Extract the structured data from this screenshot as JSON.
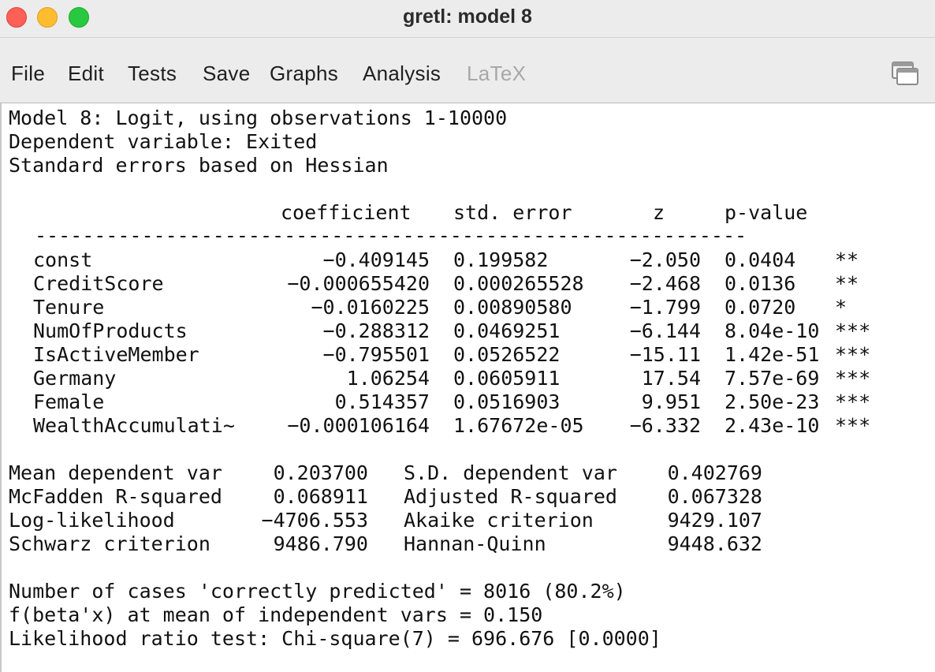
{
  "window": {
    "title": "gretl: model 8"
  },
  "menu": [
    "File",
    "Edit",
    "Tests",
    "Save",
    "Graphs",
    "Analysis",
    "LaTeX"
  ],
  "header_lines": [
    "Model 8: Logit, using observations 1-10000",
    "Dependent variable: Exited",
    "Standard errors based on Hessian"
  ],
  "table": {
    "columns": [
      "coefficient",
      "std. error",
      "z",
      "p-value"
    ],
    "separator": "------------------------------------------------------------",
    "rows": [
      {
        "var": "const",
        "coef": "−0.409145",
        "se": "0.199582",
        "z": "−2.050",
        "p": "0.0404",
        "stars": "**"
      },
      {
        "var": "CreditScore",
        "coef": "−0.000655420",
        "se": "0.000265528",
        "z": "−2.468",
        "p": "0.0136",
        "stars": "**"
      },
      {
        "var": "Tenure",
        "coef": "−0.0160225",
        "se": "0.00890580",
        "z": "−1.799",
        "p": "0.0720",
        "stars": "*"
      },
      {
        "var": "NumOfProducts",
        "coef": "−0.288312",
        "se": "0.0469251",
        "z": "−6.144",
        "p": "8.04e-10",
        "stars": "***"
      },
      {
        "var": "IsActiveMember",
        "coef": "−0.795501",
        "se": "0.0526522",
        "z": "−15.11",
        "p": "1.42e-51",
        "stars": "***"
      },
      {
        "var": "Germany",
        "coef": "1.06254",
        "se": "0.0605911",
        "z": "17.54",
        "p": "7.57e-69",
        "stars": "***"
      },
      {
        "var": "Female",
        "coef": "0.514357",
        "se": "0.0516903",
        "z": "9.951",
        "p": "2.50e-23",
        "stars": "***"
      },
      {
        "var": "WealthAccumulati~",
        "coef": "−0.000106164",
        "se": "1.67672e-05",
        "z": "−6.332",
        "p": "2.43e-10",
        "stars": "***"
      }
    ]
  },
  "stats": [
    {
      "l_label": "Mean dependent var",
      "l_val": "0.203700",
      "r_label": "S.D. dependent var",
      "r_val": "0.402769"
    },
    {
      "l_label": "McFadden R-squared",
      "l_val": "0.068911",
      "r_label": "Adjusted R-squared",
      "r_val": "0.067328"
    },
    {
      "l_label": "Log-likelihood",
      "l_val": "−4706.553",
      "r_label": "Akaike criterion",
      "r_val": "9429.107"
    },
    {
      "l_label": "Schwarz criterion",
      "l_val": "9486.790",
      "r_label": "Hannan-Quinn",
      "r_val": "9448.632"
    }
  ],
  "footer_lines": [
    "Number of cases 'correctly predicted' = 8016 (80.2%)",
    "f(beta'x) at mean of independent vars = 0.150",
    "Likelihood ratio test: Chi-square(7) = 696.676 [0.0000]"
  ]
}
